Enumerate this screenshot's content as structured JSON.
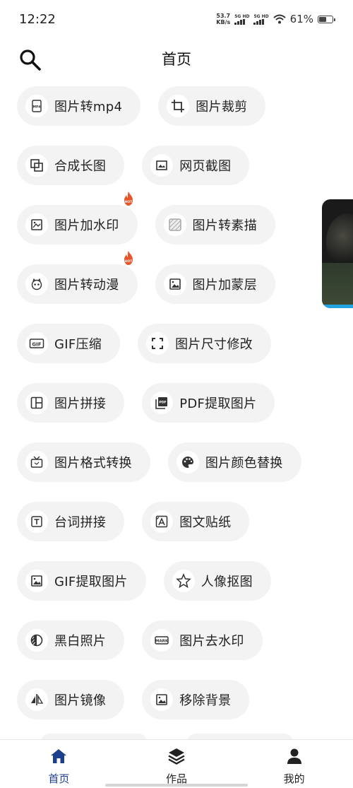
{
  "status_bar": {
    "time": "12:22",
    "net_speed_value": "53.7",
    "net_speed_unit": "KB/s",
    "sim1_label": "5G HD",
    "sim2_label": "5G HD",
    "battery_percent": "61%",
    "battery_level": 0.61,
    "icons": [
      "wifi-icon",
      "battery-icon"
    ]
  },
  "header": {
    "title": "首页",
    "search_icon": "search-icon"
  },
  "tool_rows": [
    [
      {
        "label": "图片转mp4",
        "icon": "mp4-icon",
        "hot": false
      },
      {
        "label": "图片裁剪",
        "icon": "crop-icon",
        "hot": false
      }
    ],
    [
      {
        "label": "合成长图",
        "icon": "merge-icon",
        "hot": false
      },
      {
        "label": "网页截图",
        "icon": "screenshot-icon",
        "hot": false
      }
    ],
    [
      {
        "label": "图片加水印",
        "icon": "watermark-icon",
        "hot": true
      },
      {
        "label": "图片转素描",
        "icon": "sketch-icon",
        "hot": false
      }
    ],
    [
      {
        "label": "图片转动漫",
        "icon": "anime-icon",
        "hot": true
      },
      {
        "label": "图片加蒙层",
        "icon": "image-icon",
        "hot": false
      }
    ],
    [
      {
        "label": "GIF压缩",
        "icon": "gif-icon",
        "hot": false
      },
      {
        "label": "图片尺寸修改",
        "icon": "resize-icon",
        "hot": false
      }
    ],
    [
      {
        "label": "图片拼接",
        "icon": "layout-icon",
        "hot": false
      },
      {
        "label": "PDF提取图片",
        "icon": "pdf-icon",
        "hot": false
      }
    ],
    [
      {
        "label": "图片格式转换",
        "icon": "tv-icon",
        "hot": false
      },
      {
        "label": "图片颜色替换",
        "icon": "palette-icon",
        "hot": false
      }
    ],
    [
      {
        "label": "台词拼接",
        "icon": "text-box-icon",
        "hot": false
      },
      {
        "label": "图文贴纸",
        "icon": "text-image-icon",
        "hot": false
      }
    ],
    [
      {
        "label": "GIF提取图片",
        "icon": "image-icon",
        "hot": false
      },
      {
        "label": "人像抠图",
        "icon": "portrait-cutout-icon",
        "hot": false
      }
    ],
    [
      {
        "label": "黑白照片",
        "icon": "contrast-icon",
        "hot": false
      },
      {
        "label": "图片去水印",
        "icon": "remove-watermark-icon",
        "hot": false
      }
    ],
    [
      {
        "label": "图片镜像",
        "icon": "mirror-icon",
        "hot": false
      },
      {
        "label": "移除背景",
        "icon": "image-icon",
        "hot": false
      }
    ]
  ],
  "hot_badge_text": "HOT",
  "bottom_nav": [
    {
      "label": "首页",
      "icon": "home-icon",
      "active": true
    },
    {
      "label": "作品",
      "icon": "layers-icon",
      "active": false
    },
    {
      "label": "我的",
      "icon": "person-icon",
      "active": false
    }
  ],
  "colors": {
    "accent": "#1d3f8f",
    "chip_bg": "#f3f3f3",
    "hot_badge": "#e8552b",
    "float_progress": "#23a3e0"
  }
}
